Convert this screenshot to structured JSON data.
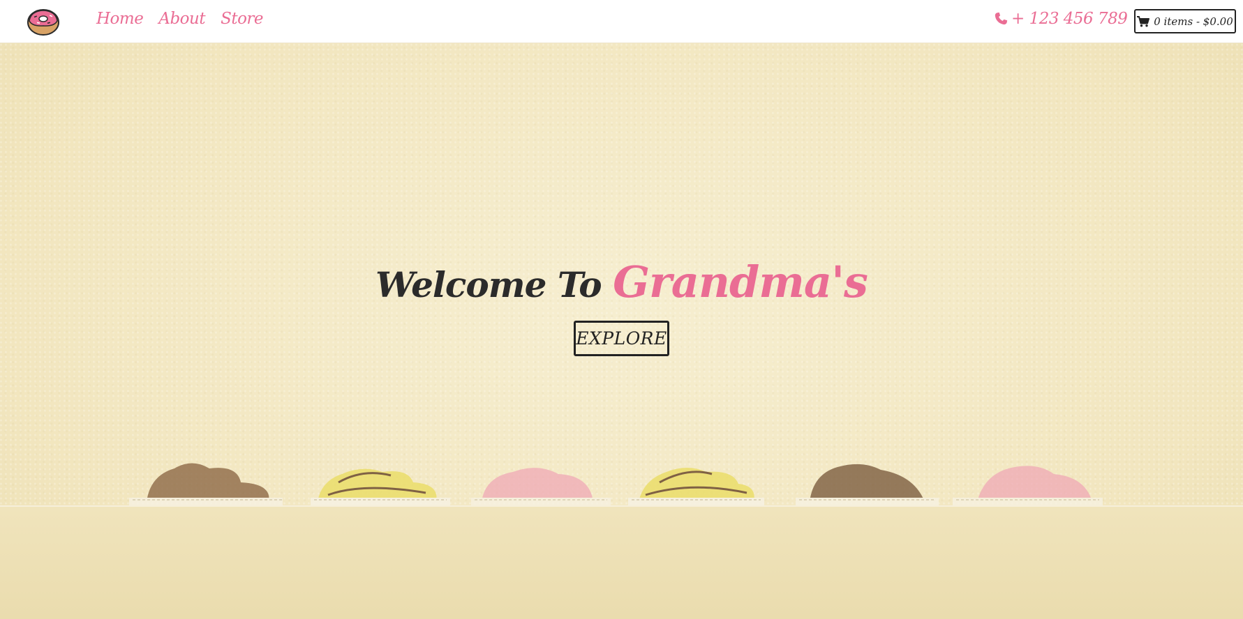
{
  "nav": {
    "links": [
      "Home",
      "About",
      "Store"
    ],
    "phone": "+ 123 456 789",
    "cart_label": "0 items - $0.00"
  },
  "hero": {
    "welcome": "Welcome To",
    "brand": "Grandma's",
    "cta": "EXPLORE"
  },
  "colors": {
    "accent": "#ea6d94",
    "dark": "#222222",
    "background": "#f3e9c6"
  },
  "icons": [
    "donut-logo-icon",
    "phone-icon",
    "cart-icon"
  ]
}
